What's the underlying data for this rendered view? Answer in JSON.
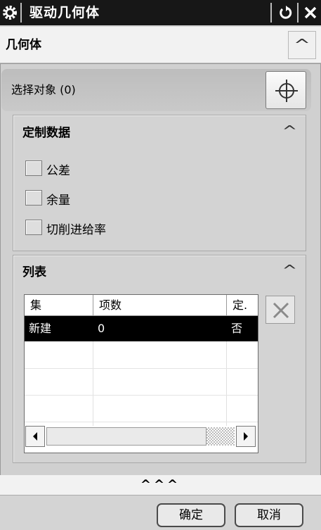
{
  "window": {
    "title": "驱动几何体",
    "gear_icon": "gear-icon",
    "reset_icon": "reset-icon",
    "close_icon": "close-icon"
  },
  "geometry": {
    "header": "几何体",
    "select_object_label": "选择对象 (0)",
    "select_icon": "crosshair-icon"
  },
  "custom_data": {
    "title": "定制数据",
    "options": [
      {
        "label": "公差",
        "checked": false
      },
      {
        "label": "余量",
        "checked": false
      },
      {
        "label": "切削进给率",
        "checked": false
      }
    ]
  },
  "list": {
    "title": "列表",
    "columns": [
      "集",
      "项数",
      "定."
    ],
    "rows": [
      {
        "cells": [
          "新建",
          "0",
          "否"
        ],
        "selected": true
      }
    ],
    "delete_icon": "delete-icon"
  },
  "more": {
    "label": "^^^"
  },
  "buttons": {
    "ok": "确定",
    "cancel": "取消"
  }
}
